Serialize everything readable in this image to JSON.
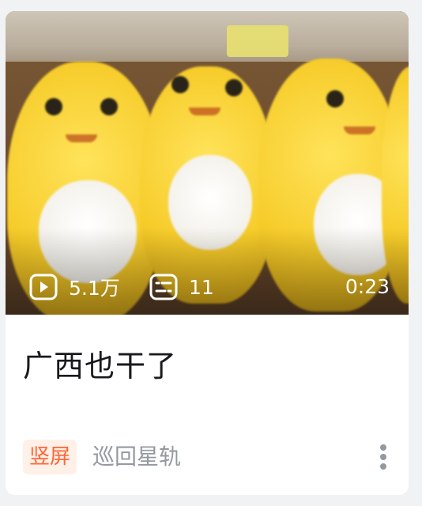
{
  "video_card": {
    "play_count": "5.1万",
    "danmaku_count": "11",
    "duration": "0:23",
    "title": "广西也干了",
    "badge": "竖屏",
    "author": "巡回星轨",
    "icons": {
      "play": "play-count-icon",
      "danmaku": "danmaku-count-icon",
      "more": "more-vertical-icon"
    }
  }
}
